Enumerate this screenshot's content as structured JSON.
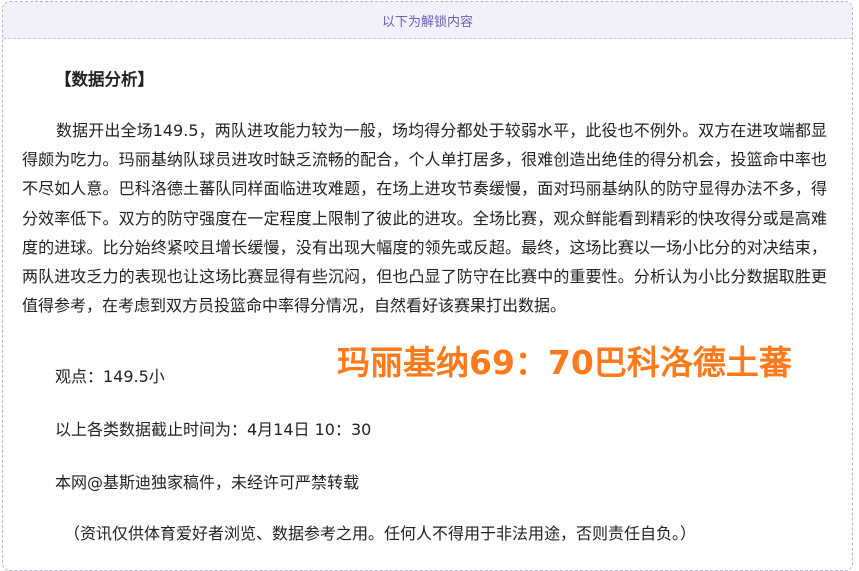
{
  "unlock_banner": "以下为解锁内容",
  "section_heading": "【数据分析】",
  "analysis_paragraph": "数据开出全场149.5，两队进攻能力较为一般，场均得分都处于较弱水平，此役也不例外。双方在进攻端都显得颇为吃力。玛丽基纳队球员进攻时缺乏流畅的配合，个人单打居多，很难创造出绝佳的得分机会，投篮命中率也不尽如人意。巴科洛德土蕃队同样面临进攻难题，在场上进攻节奏缓慢，面对玛丽基纳队的防守显得办法不多，得分效率低下。双方的防守强度在一定程度上限制了彼此的进攻。全场比赛，观众鲜能看到精彩的快攻得分或是高难度的进球。比分始终紧咬且增长缓慢，没有出现大幅度的领先或反超。最终，这场比赛以一场小比分的对决结束，两队进攻乏力的表现也让这场比赛显得有些沉闷，但也凸显了防守在比赛中的重要性。分析认为小比分数据取胜更值得参考，在考虑到双方员投篮命中率得分情况，自然看好该赛果打出数据。",
  "viewpoint": "观点：149.5小",
  "cutoff_time": "以上各类数据截止时间为：4月14日 10：30",
  "copyright": "本网@基斯迪独家稿件，未经许可严禁转载",
  "disclaimer": "（资讯仅供体育爱好者浏览、数据参考之用。任何人不得用于非法用途，否则责任自负。）",
  "score_overlay": "玛丽基纳69：70巴科洛德土蕃",
  "colors": {
    "score_text": "#ff7a1a",
    "banner_text": "#6a5fb0",
    "banner_bg": "#f2f0fb",
    "border": "#b9b1dc"
  }
}
